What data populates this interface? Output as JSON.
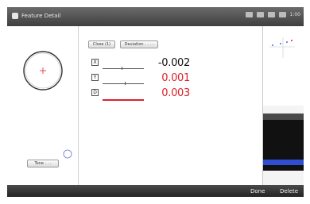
{
  "window": {
    "title": "Feature Detail",
    "time": "1:00"
  },
  "toolbar": {
    "close_label": "Close (1)",
    "deviation_label": "Deviation . . . ."
  },
  "left": {
    "tone_label": "Tone . . ."
  },
  "measurements": [
    {
      "axis": "X",
      "value": "-0.002",
      "color": "#111111"
    },
    {
      "axis": "Y",
      "value": "0.001",
      "color": "#e0202a"
    },
    {
      "axis": "D",
      "value": "0.003",
      "color": "#e0202a"
    }
  ],
  "colors": {
    "accent_red": "#e0202a",
    "selection_blue": "#2e4fd1"
  },
  "footer": {
    "done_label": "Done",
    "delete_label": "Delete"
  }
}
